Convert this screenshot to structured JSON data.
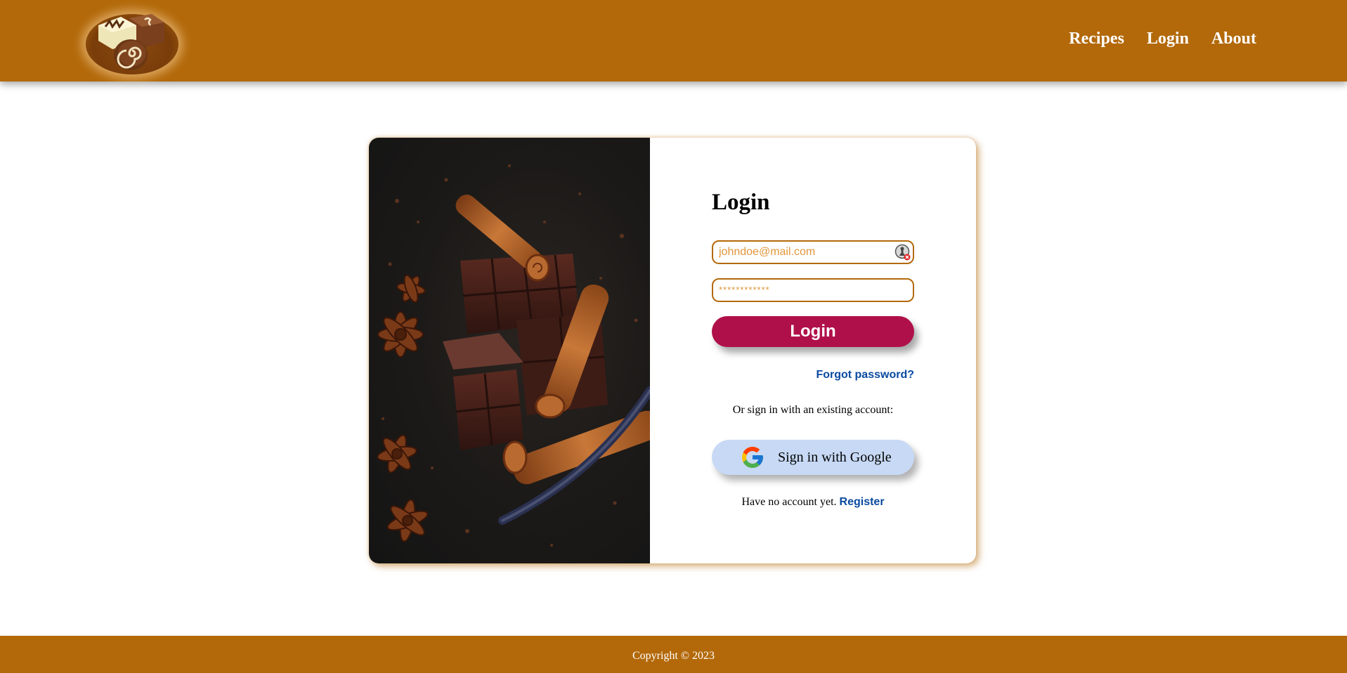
{
  "header": {
    "logo_alt": "chocolate candies logo",
    "nav": [
      {
        "label": "Recipes"
      },
      {
        "label": "Login"
      },
      {
        "label": "About"
      }
    ]
  },
  "login_card": {
    "image_alt": "chocolate with cinnamon sticks, star anise and vanilla",
    "title": "Login",
    "email": {
      "placeholder": "johndoe@mail.com",
      "value": ""
    },
    "password": {
      "placeholder": "************",
      "value": ""
    },
    "login_button": "Login",
    "forgot_password": "Forgot password?",
    "alt_signin_text": "Or sign in with an existing account:",
    "google_button": "Sign in with Google",
    "no_account_text": "Have no account yet.",
    "register_link": "Register"
  },
  "footer": {
    "copyright": "Copyright © 2023"
  },
  "colors": {
    "brand": "#b3690a",
    "login_button": "#b0104a",
    "link": "#0a4aa0",
    "google_button_bg": "#c7d9f5"
  }
}
